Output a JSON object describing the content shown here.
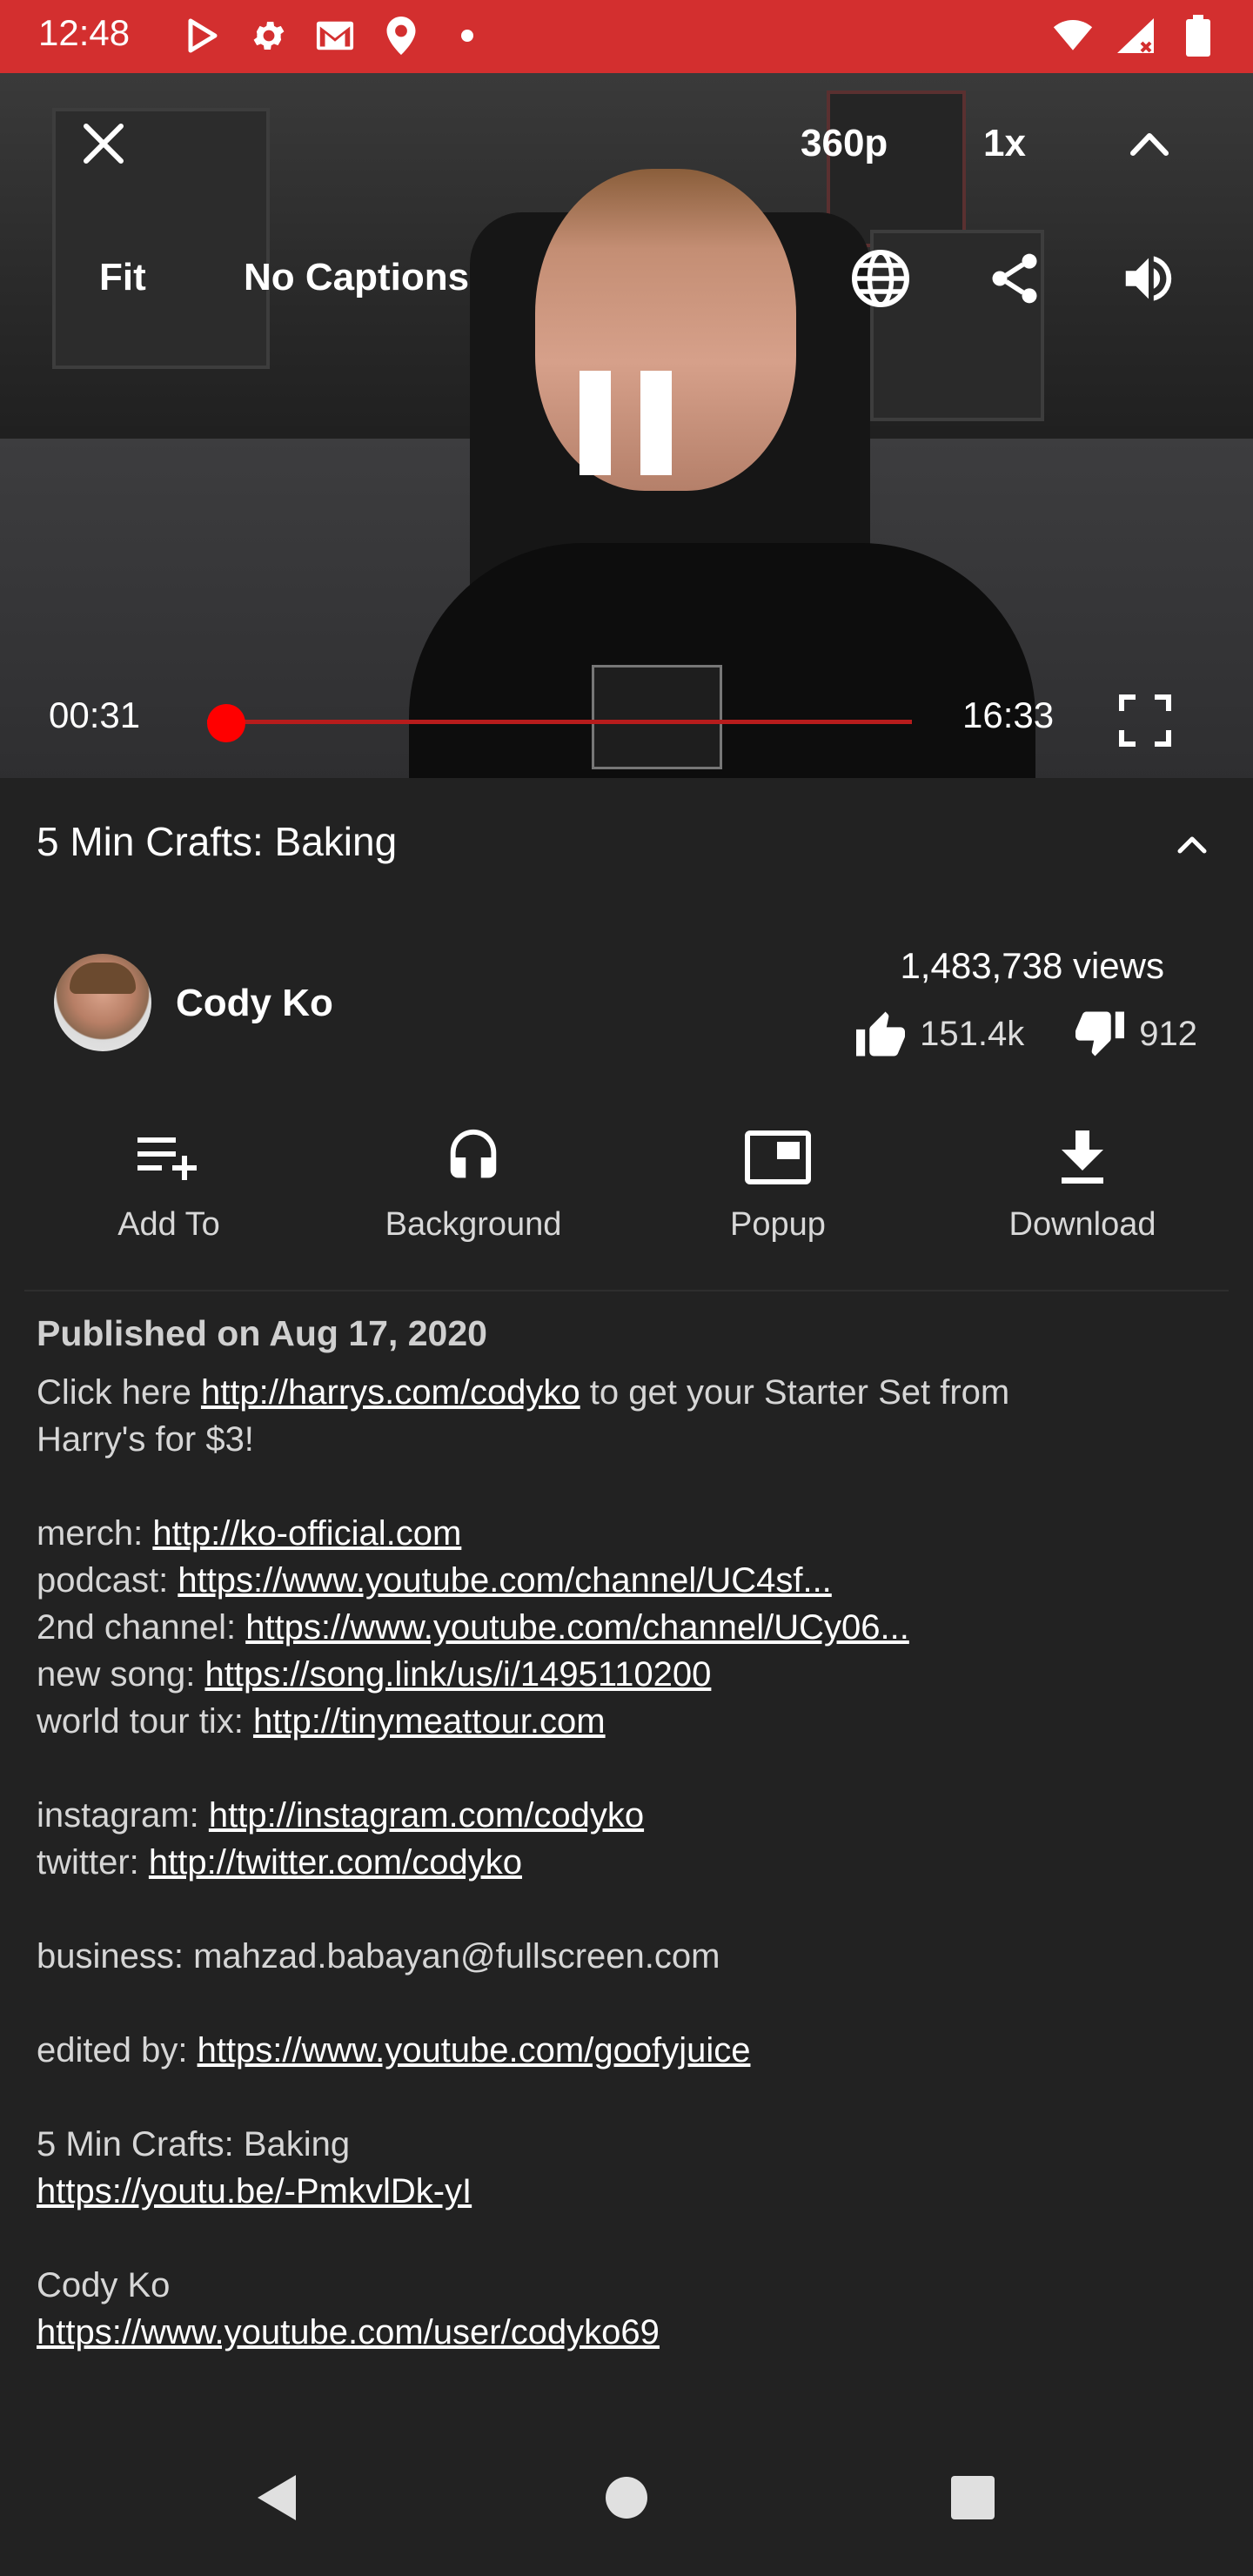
{
  "status_bar": {
    "time": "12:48",
    "left_icons": [
      "play-store-icon",
      "settings-icon",
      "gmail-icon",
      "location-icon",
      "dot-icon"
    ],
    "right_icons": [
      "wifi-icon",
      "signal-icon",
      "battery-icon"
    ],
    "background_color": "#d32f2f"
  },
  "player": {
    "quality": "360p",
    "speed": "1x",
    "resize_mode": "Fit",
    "captions": "No Captions",
    "current_time": "00:31",
    "duration": "16:33",
    "progress_fraction": 0.031,
    "accent_color": "#ff0000"
  },
  "video": {
    "title": "5 Min Crafts: Baking",
    "channel": "Cody Ko",
    "views": "1,483,738 views",
    "likes": "151.4k",
    "dislikes": "912"
  },
  "actions": [
    {
      "label": "Add To",
      "icon": "playlist-add-icon"
    },
    {
      "label": "Background",
      "icon": "headphones-icon"
    },
    {
      "label": "Popup",
      "icon": "popup-icon"
    },
    {
      "label": "Download",
      "icon": "download-icon"
    }
  ],
  "description": {
    "published": "Published on Aug 17, 2020",
    "line1_prefix": "Click here ",
    "line1_link": "http://harrys.com/codyko",
    "line1_suffix": " to get your Starter Set from",
    "line2": "Harry's for $3!",
    "merch_label": "merch: ",
    "merch_link": "http://ko-official.com",
    "podcast_label": "podcast: ",
    "podcast_link": "https://www.youtube.com/channel/UC4sf...",
    "channel2_label": "2nd channel: ",
    "channel2_link": "https://www.youtube.com/channel/UCy06...",
    "song_label": "new song: ",
    "song_link": "https://song.link/us/i/1495110200",
    "tour_label": "world tour tix: ",
    "tour_link": "http://tinymeattour.com",
    "instagram_label": "instagram: ",
    "instagram_link": "http://instagram.com/codyko",
    "twitter_label": "twitter: ",
    "twitter_link": "http://twitter.com/codyko",
    "business": "business: mahzad.babayan@fullscreen.com",
    "edited_label": "edited by: ",
    "edited_link": "https://www.youtube.com/goofyjuice",
    "related_title": "5 Min Crafts: Baking",
    "related_link": "https://youtu.be/-PmkvlDk-yI",
    "channel_title": "Cody Ko",
    "channel_link": "https://www.youtube.com/user/codyko69"
  },
  "nav_bar": {
    "buttons": [
      "back-icon",
      "home-icon",
      "recents-icon"
    ]
  }
}
